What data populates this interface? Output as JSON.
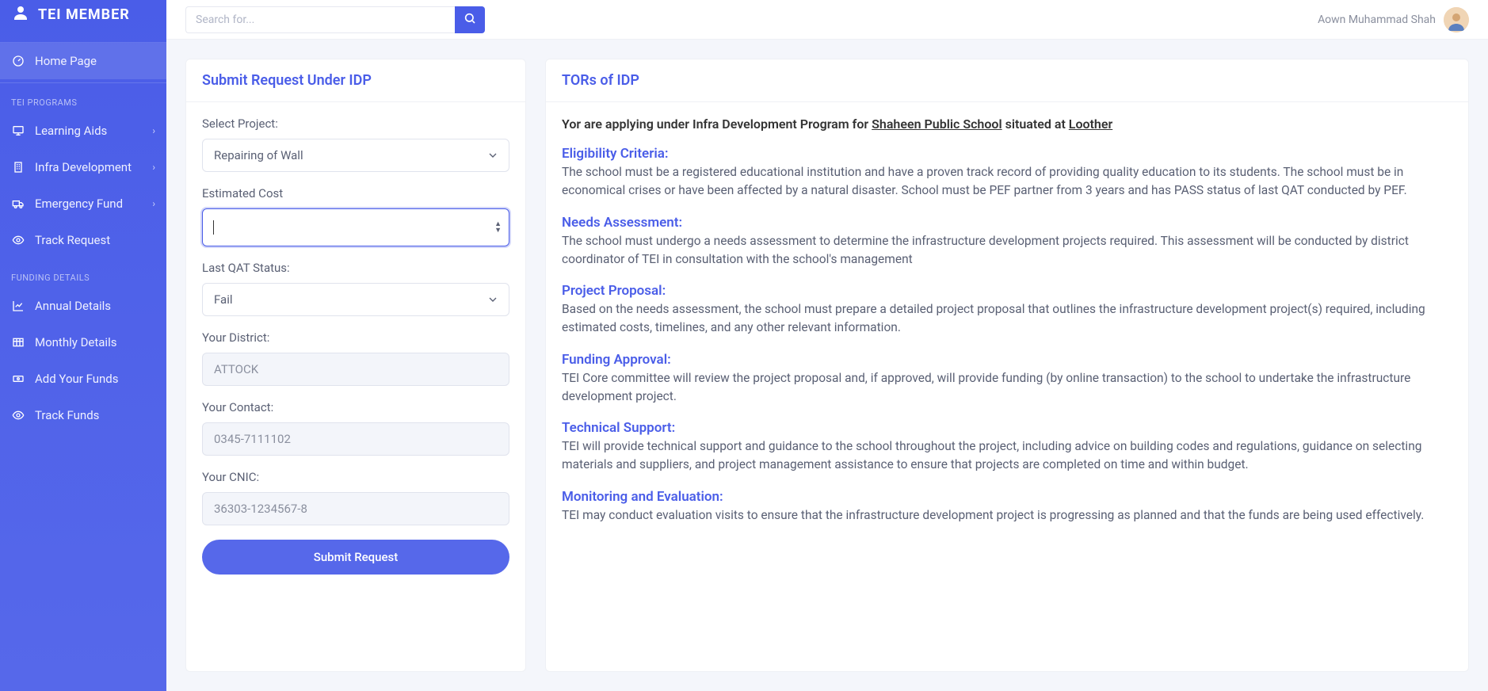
{
  "brand": "TEI MEMBER",
  "search": {
    "placeholder": "Search for..."
  },
  "user": {
    "name": "Aown Muhammad Shah"
  },
  "sidebar": {
    "home": "Home Page",
    "section_programs": "TEI PROGRAMS",
    "learning_aids": "Learning Aids",
    "infra_dev": "Infra Development",
    "emergency_fund": "Emergency Fund",
    "track_request": "Track Request",
    "section_funding": "FUNDING DETAILS",
    "annual": "Annual Details",
    "monthly": "Monthly Details",
    "add_funds": "Add Your Funds",
    "track_funds": "Track Funds"
  },
  "form": {
    "title": "Submit Request Under IDP",
    "labels": {
      "project": "Select Project:",
      "cost": "Estimated Cost",
      "qat": "Last QAT Status:",
      "district": "Your District:",
      "contact": "Your Contact:",
      "cnic": "Your CNIC:"
    },
    "project_value": "Repairing of Wall",
    "cost_value": "",
    "qat_value": "Fail",
    "district_value": "ATTOCK",
    "contact_value": "0345-7111102",
    "cnic_value": "36303-1234567-8",
    "submit": "Submit Request"
  },
  "tors": {
    "title": "TORs of IDP",
    "intro_pre": "Yor are applying under Infra Development Program for ",
    "school": "Shaheen Public School",
    "intro_mid": " situated at ",
    "location": "Loother",
    "sections": [
      {
        "title": "Eligibility Criteria:",
        "body": "The school must be a registered educational institution and have a proven track record of providing quality education to its students. The school must be in economical crises or have been affected by a natural disaster. School must be PEF partner from 3 years and has PASS status of last QAT conducted by PEF."
      },
      {
        "title": "Needs Assessment:",
        "body": "The school must undergo a needs assessment to determine the infrastructure development projects required. This assessment will be conducted by district coordinator of TEI in consultation with the school's management"
      },
      {
        "title": "Project Proposal:",
        "body": "Based on the needs assessment, the school must prepare a detailed project proposal that outlines the infrastructure development project(s) required, including estimated costs, timelines, and any other relevant information."
      },
      {
        "title": "Funding Approval:",
        "body": "TEI Core committee will review the project proposal and, if approved, will provide funding (by online transaction) to the school to undertake the infrastructure development project."
      },
      {
        "title": "Technical Support:",
        "body": "TEI will provide technical support and guidance to the school throughout the project, including advice on building codes and regulations, guidance on selecting materials and suppliers, and project management assistance to ensure that projects are completed on time and within budget."
      },
      {
        "title": "Monitoring and Evaluation:",
        "body": "TEI may conduct evaluation visits to ensure that the infrastructure development project is progressing as planned and that the funds are being used effectively."
      }
    ]
  }
}
